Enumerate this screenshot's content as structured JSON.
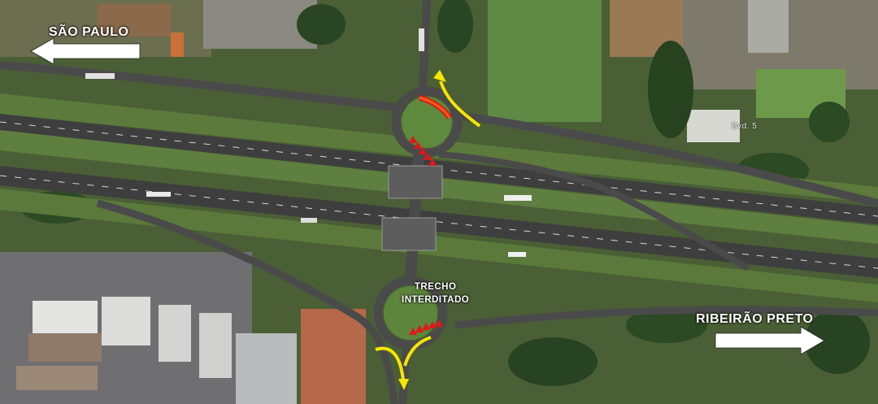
{
  "map": {
    "labels": {
      "sao_paulo": "SÃO PAULO",
      "ribeirao_preto": "RIBEIRÃO PRETO",
      "closed_line1": "TRECHO",
      "closed_line2": "INTERDITADO",
      "boulevard": "Bvd. 5"
    },
    "icons": {
      "west_arrow": "arrow-left-icon",
      "east_arrow": "arrow-right-icon",
      "detour_arrow": "curved-arrow-icon",
      "closure_marker": "traffic-cone-icon"
    },
    "colors": {
      "direction_arrow": "#ffffff",
      "detour_arrow": "#f5e600",
      "closure_mark": "#e01818",
      "closure_bar": "#e8601c",
      "road": "#3f3f3f",
      "grass": "#4f6b36"
    }
  }
}
